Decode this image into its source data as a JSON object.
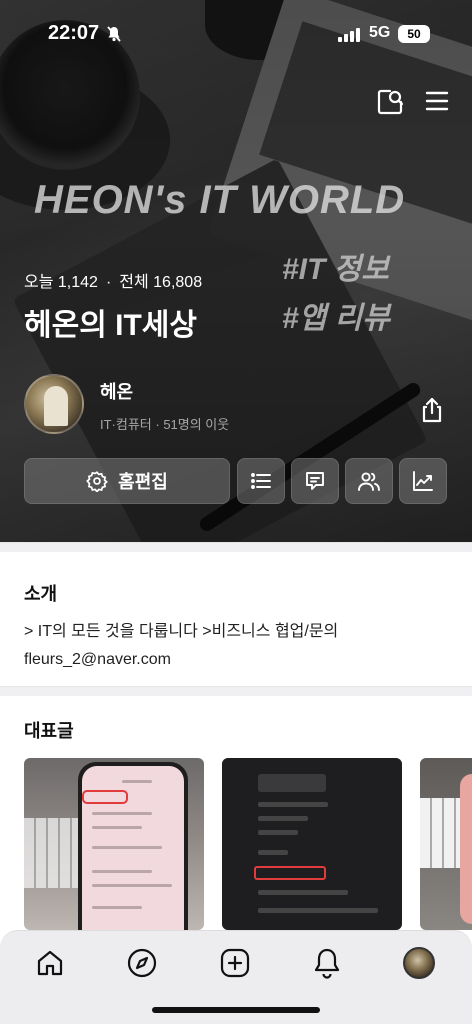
{
  "status_bar": {
    "time": "22:07",
    "network": "5G",
    "battery": "50"
  },
  "hero": {
    "brand_title": "HEON's IT WORLD",
    "tags": [
      "#IT 정보",
      "#앱 리뷰"
    ],
    "stats": {
      "today": "오늘 1,142",
      "separator": "·",
      "total": "전체 16,808"
    },
    "blog_title": "헤온의 IT세상",
    "owner": {
      "name": "헤온",
      "meta": "IT·컴퓨터 · 51명의 이웃"
    },
    "actions": {
      "edit_label": "홈편집"
    }
  },
  "intro": {
    "heading": "소개",
    "text": "> IT의 모든 것을 다룹니다 >비즈니스 협업/문의 fleurs_2@naver.com"
  },
  "featured": {
    "heading": "대표글"
  },
  "icons": {
    "top": [
      "search-icon",
      "menu-icon"
    ],
    "owner": [
      "share-icon"
    ],
    "actions": [
      "gear-icon",
      "list-icon",
      "comment-icon",
      "neighbors-icon",
      "stats-icon"
    ],
    "tabbar": [
      "home-icon",
      "explore-icon",
      "write-icon",
      "notification-icon",
      "profile-avatar"
    ]
  }
}
